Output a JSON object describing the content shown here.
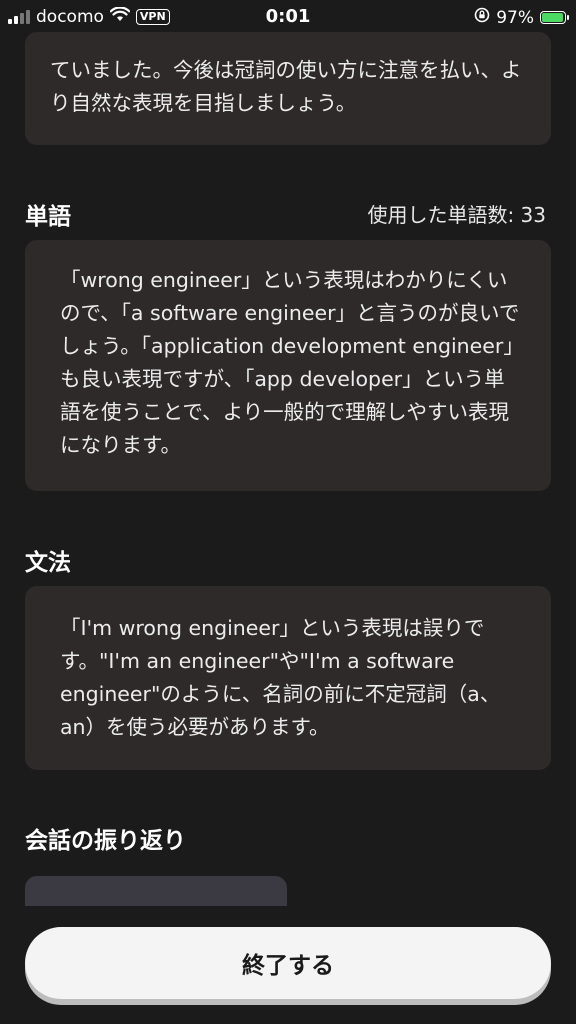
{
  "status_bar": {
    "carrier": "docomo",
    "vpn": "VPN",
    "time": "0:01",
    "battery_percent": "97%",
    "battery_level": 0.97,
    "icons": [
      "signal-icon",
      "wifi-icon",
      "orientation-lock-icon",
      "battery-charging-icon"
    ]
  },
  "feedback": {
    "top_card_text": "ていました。今後は冠詞の使い方に注意を払い、より自然な表現を目指しましょう。",
    "words": {
      "title": "単語",
      "count_label": "使用した単語数: 33",
      "text": "「wrong engineer」という表現はわかりにくいので、「a software engineer」と言うのが良いでしょう。「application development engineer」も良い表現ですが、「app developer」という単語を使うことで、より一般的で理解しやすい表現になります。"
    },
    "grammar": {
      "title": "文法",
      "text": "「I'm wrong engineer」という表現は誤りです。\"I'm an engineer\"や\"I'm a software engineer\"のように、名詞の前に不定冠詞（a、an）を使う必要があります。"
    },
    "review": {
      "title": "会話の振り返り"
    }
  },
  "actions": {
    "finish_label": "終了する"
  },
  "colors": {
    "background": "#1c1b1b",
    "card": "#2d2a29",
    "button": "#f4f4f4",
    "battery": "#4cd964"
  }
}
